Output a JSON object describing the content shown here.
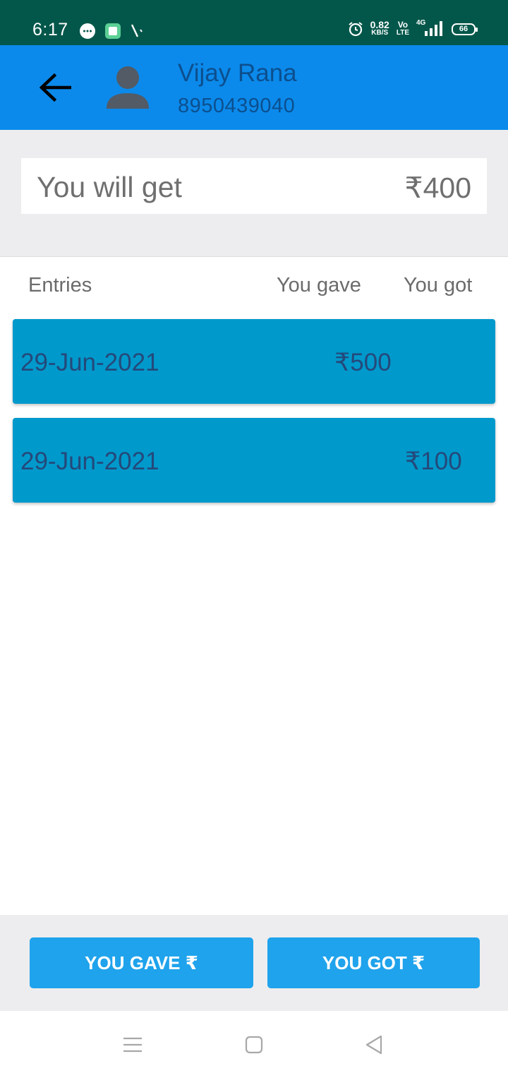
{
  "status_bar": {
    "time": "6:17",
    "net_speed_value": "0.82",
    "net_speed_unit": "KB/S",
    "volte_top": "Vo",
    "volte_bottom": "LTE",
    "network": "4G",
    "battery": "66"
  },
  "header": {
    "contact_name": "Vijay Rana",
    "contact_phone": "8950439040"
  },
  "summary": {
    "label": "You will get",
    "amount": "₹400"
  },
  "columns": {
    "entries": "Entries",
    "you_gave": "You gave",
    "you_got": "You got"
  },
  "entries": [
    {
      "date": "29-Jun-2021",
      "amount": "₹500",
      "type": "gave"
    },
    {
      "date": "29-Jun-2021",
      "amount": "₹100",
      "type": "got"
    }
  ],
  "actions": {
    "you_gave": "YOU GAVE ₹",
    "you_got": "YOU GOT ₹"
  },
  "colors": {
    "status_bar": "#03574a",
    "app_bar": "#0b8aeb",
    "entry_bg": "#0099cc",
    "button": "#1fa3ec"
  }
}
